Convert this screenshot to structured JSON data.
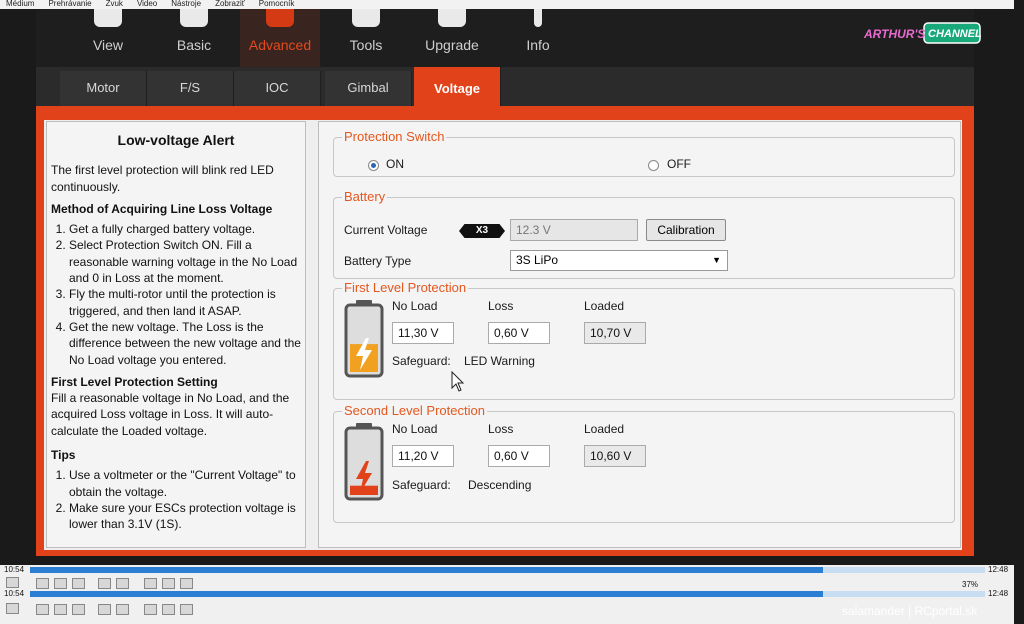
{
  "menubar": {
    "items": [
      "Médium",
      "Prehrávanie",
      "Zvuk",
      "Video",
      "Nástroje",
      "Zobraziť",
      "Pomocník"
    ]
  },
  "topnav": {
    "items": [
      {
        "label": "View",
        "icon": "view-icon"
      },
      {
        "label": "Basic",
        "icon": "basic-icon"
      },
      {
        "label": "Advanced",
        "icon": "advanced-icon",
        "active": true
      },
      {
        "label": "Tools",
        "icon": "tools-icon"
      },
      {
        "label": "Upgrade",
        "icon": "upgrade-icon"
      },
      {
        "label": "Info",
        "icon": "info-icon"
      }
    ],
    "brand": "ARTHUR'S CHANNEL"
  },
  "tabs": [
    {
      "label": "Motor"
    },
    {
      "label": "F/S"
    },
    {
      "label": "IOC"
    },
    {
      "label": "Gimbal"
    },
    {
      "label": "Voltage",
      "active": true
    }
  ],
  "help": {
    "title": "Low-voltage Alert",
    "intro": "The first level protection will blink red LED continuously.",
    "method_heading": "Method of Acquiring Line Loss Voltage",
    "method_steps": [
      "Get a fully charged battery voltage.",
      "Select Protection Switch ON. Fill a reasonable warning voltage in the No Load and 0 in Loss at the moment.",
      "Fly the multi-rotor until the protection is triggered, and then land it ASAP.",
      "Get the new voltage. The Loss is the difference between the new voltage and the No Load voltage you entered."
    ],
    "first_heading": "First Level Protection Setting",
    "first_text": "Fill a reasonable voltage in No Load, and the acquired Loss voltage in Loss. It will auto-calculate the Loaded voltage.",
    "tips_heading": "Tips",
    "tips": [
      "Use a voltmeter or the \"Current Voltage\" to obtain the voltage.",
      "Make sure your ESCs protection voltage is lower than 3.1V (1S)."
    ]
  },
  "protection_switch": {
    "title": "Protection Switch",
    "on_label": "ON",
    "off_label": "OFF",
    "selected": "ON"
  },
  "battery": {
    "title": "Battery",
    "current_voltage_label": "Current Voltage",
    "cell_badge": "X3",
    "current_voltage": "12.3 V",
    "calibration_label": "Calibration",
    "type_label": "Battery Type",
    "type_value": "3S LiPo"
  },
  "first_level": {
    "title": "First Level Protection",
    "no_load_label": "No Load",
    "loss_label": "Loss",
    "loaded_label": "Loaded",
    "no_load": "11,30 V",
    "loss": "0,60 V",
    "loaded": "10,70 V",
    "safeguard_label": "Safeguard:",
    "safeguard_value": "LED Warning",
    "battery_level": 0.45
  },
  "second_level": {
    "title": "Second Level Protection",
    "no_load_label": "No Load",
    "loss_label": "Loss",
    "loaded_label": "Loaded",
    "no_load": "11,20 V",
    "loss": "0,60 V",
    "loaded": "10,60 V",
    "safeguard_label": "Safeguard:",
    "safeguard_value": "Descending",
    "battery_level": 0.15
  },
  "player": {
    "time_elapsed": "10:54",
    "time_total": "12:48",
    "progress": 0.83,
    "volume": "37%",
    "credit": "salamander | RCportal.sk"
  },
  "colors": {
    "accent": "#e2421a",
    "group_title": "#e4571f",
    "battery_fill": "#f2a020"
  }
}
